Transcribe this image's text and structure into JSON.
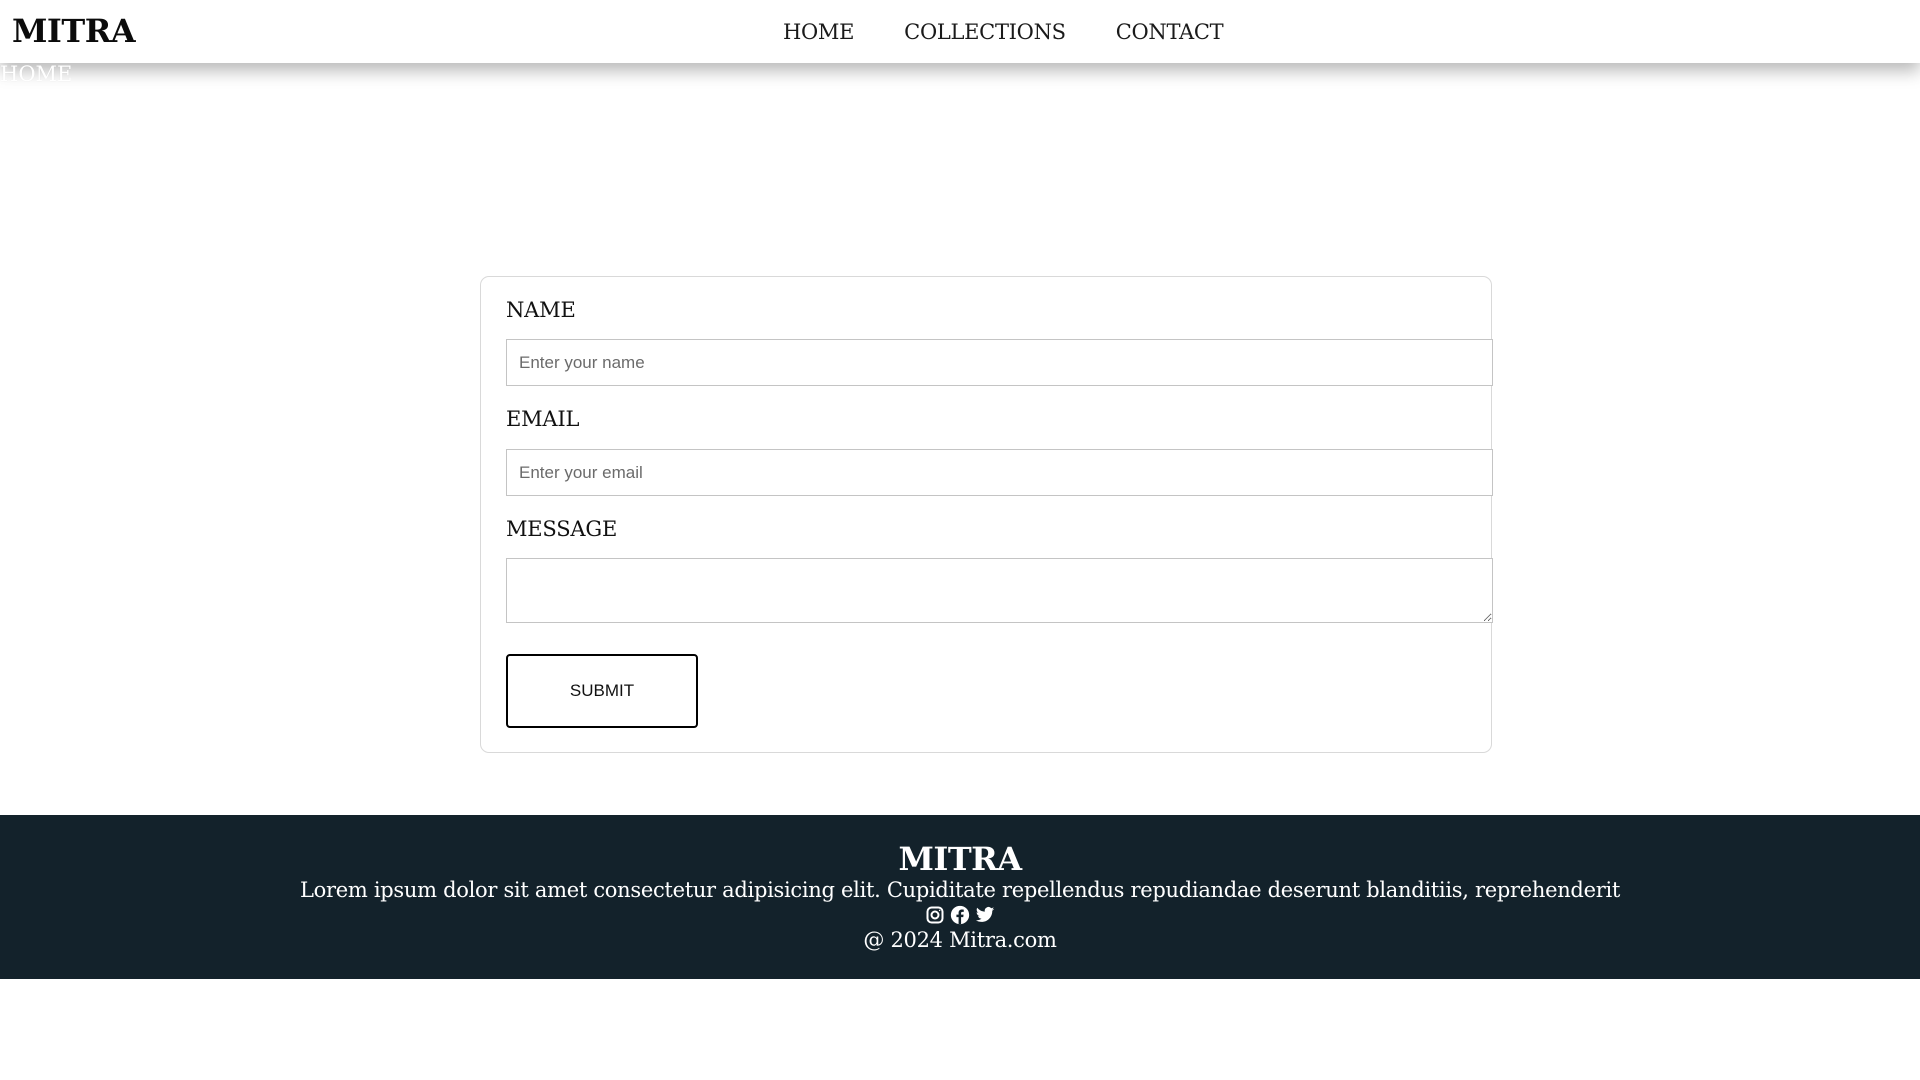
{
  "header": {
    "brand": "MITRA",
    "nav": [
      {
        "label": "HOME"
      },
      {
        "label": "COLLECTIONS"
      },
      {
        "label": "CONTACT"
      }
    ],
    "breadcrumb": "HOME"
  },
  "form": {
    "name_label": "NAME",
    "name_placeholder": "Enter your name",
    "name_value": "",
    "email_label": "EMAIL",
    "email_placeholder": "Enter your email",
    "email_value": "",
    "message_label": "MESSAGE",
    "message_value": "",
    "submit_label": "SUBMIT"
  },
  "footer": {
    "brand": "MITRA",
    "tagline": "Lorem ipsum dolor sit amet consectetur adipisicing elit. Cupiditate repellendus repudiandae deserunt blanditiis, reprehenderit",
    "social_icons": [
      "instagram-icon",
      "facebook-icon",
      "twitter-icon"
    ],
    "copyright": "@ 2024 Mitra.com"
  },
  "colors": {
    "footer_background": "#13222b",
    "page_background": "#ffffff",
    "text": "#111111"
  }
}
